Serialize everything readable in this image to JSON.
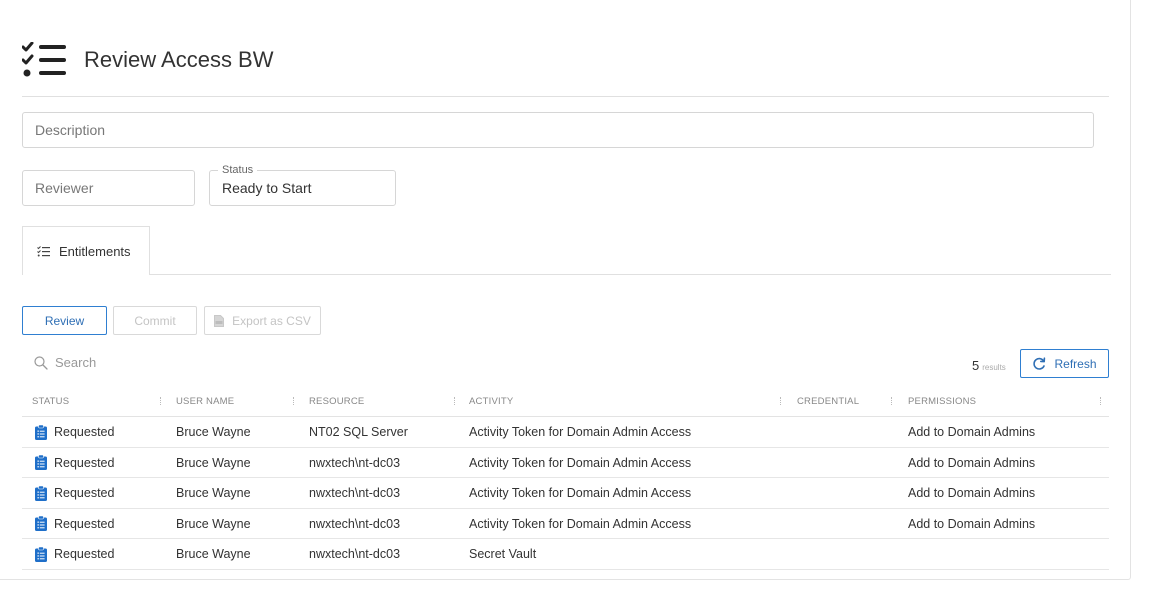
{
  "page": {
    "title": "Review Access BW",
    "header_icon": "checklist-icon"
  },
  "form": {
    "description_placeholder": "Description",
    "reviewer_placeholder": "Reviewer",
    "status_label": "Status",
    "status_value": "Ready to Start"
  },
  "tabs": [
    {
      "label": "Entitlements",
      "icon": "checklist-icon",
      "active": true
    }
  ],
  "toolbar": {
    "review_label": "Review",
    "commit_label": "Commit",
    "export_label": "Export as CSV",
    "search_placeholder": "Search",
    "results_count": "5",
    "results_unit": "results",
    "refresh_label": "Refresh"
  },
  "colors": {
    "accent": "#2f7fd1",
    "status_icon": "#1f6fc9"
  },
  "table": {
    "columns": [
      "STATUS",
      "USER NAME",
      "RESOURCE",
      "ACTIVITY",
      "CREDENTIAL",
      "PERMISSIONS"
    ],
    "rows": [
      {
        "status": "Requested",
        "user": "Bruce Wayne",
        "resource": "NT02 SQL Server",
        "activity": "Activity Token for Domain Admin Access",
        "credential": "",
        "permissions": "Add to Domain Admins"
      },
      {
        "status": "Requested",
        "user": "Bruce Wayne",
        "resource": "nwxtech\\nt-dc03",
        "activity": "Activity Token for Domain Admin Access",
        "credential": "",
        "permissions": "Add to Domain Admins"
      },
      {
        "status": "Requested",
        "user": "Bruce Wayne",
        "resource": "nwxtech\\nt-dc03",
        "activity": "Activity Token for Domain Admin Access",
        "credential": "",
        "permissions": "Add to Domain Admins"
      },
      {
        "status": "Requested",
        "user": "Bruce Wayne",
        "resource": "nwxtech\\nt-dc03",
        "activity": "Activity Token for Domain Admin Access",
        "credential": "",
        "permissions": "Add to Domain Admins"
      },
      {
        "status": "Requested",
        "user": "Bruce Wayne",
        "resource": "nwxtech\\nt-dc03",
        "activity": "Secret Vault",
        "credential": "",
        "permissions": ""
      }
    ]
  }
}
